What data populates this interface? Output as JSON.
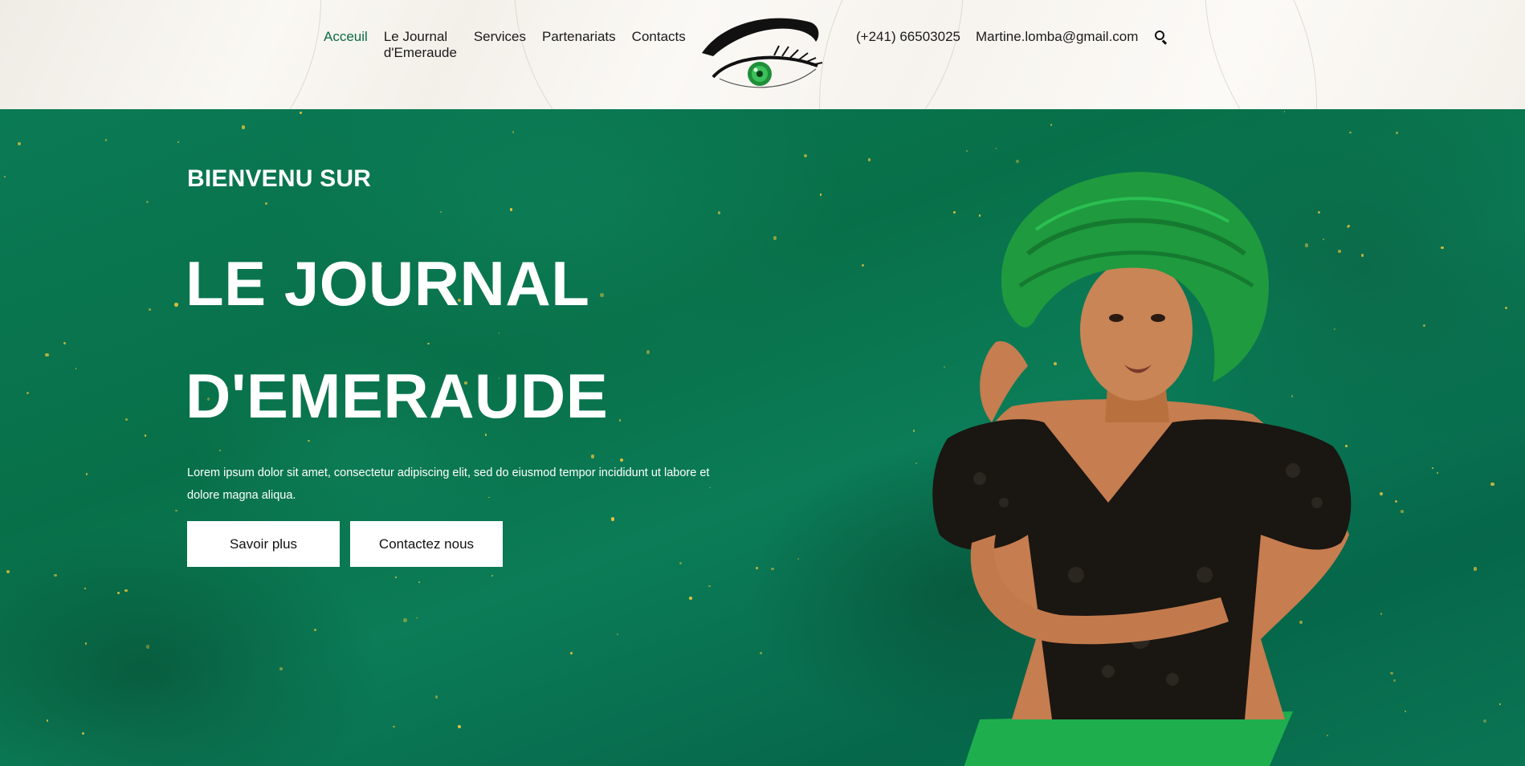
{
  "nav": {
    "items": [
      {
        "label": "Acceuil",
        "active": true
      },
      {
        "label": "Le Journal d'Emeraude",
        "active": false
      },
      {
        "label": "Services",
        "active": false
      },
      {
        "label": "Partenariats",
        "active": false
      },
      {
        "label": "Contacts",
        "active": false
      }
    ],
    "active_color": "#0a6b45"
  },
  "logo": {
    "icon": "emerald-eye-logo"
  },
  "contact": {
    "phone": "(+241) 66503025",
    "email": "Martine.lomba@gmail.com",
    "search_icon": "search-icon"
  },
  "hero": {
    "eyebrow": "BIENVENU SUR",
    "title_line1": "LE JOURNAL",
    "title_line2": "D'EMERAUDE",
    "description": "Lorem ipsum dolor sit amet, consectetur adipiscing elit, sed do eiusmod tempor incididunt ut labore et dolore magna aliqua.",
    "primary_button": "Savoir plus",
    "secondary_button": "Contactez nous",
    "background_color": "#0a7a55",
    "accent_gold": "#e6c23c"
  }
}
